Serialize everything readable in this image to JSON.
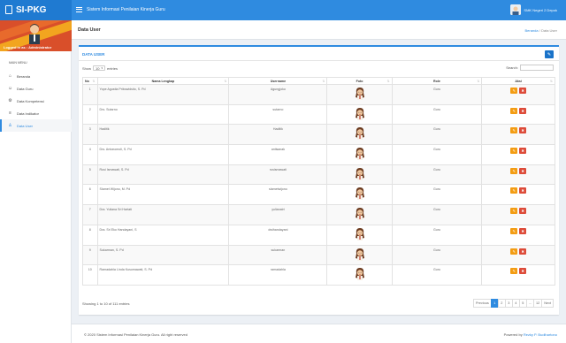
{
  "app": {
    "logo": "SI-PKG",
    "title": "Sistem Informasi Penilaian Kinerja Guru",
    "user_name": "SMK Negeri 2 Depok"
  },
  "sidebar": {
    "logged_in": "Logged in as : Administrator",
    "menu_header": "MAIN MENU",
    "items": [
      {
        "label": "Beranda",
        "icon": "home-icon"
      },
      {
        "label": "Data Guru",
        "icon": "users-icon"
      },
      {
        "label": "Data Kompetensi",
        "icon": "gear-icon"
      },
      {
        "label": "Data Indikator",
        "icon": "list-icon"
      },
      {
        "label": "Data User",
        "icon": "user-icon"
      }
    ]
  },
  "header": {
    "page_title": "Data User",
    "breadcrumb_home": "Beranda",
    "breadcrumb_current": "Data User"
  },
  "box": {
    "title": "DATA USER"
  },
  "table_controls": {
    "show_label": "Show",
    "entries_value": "10",
    "entries_label": "entries",
    "search_label": "Search:"
  },
  "table": {
    "columns": [
      "No",
      "Nama Lengkap",
      "Username",
      "Foto",
      "Role",
      "Aksi"
    ],
    "rows": [
      {
        "no": "1",
        "nama": "Yope Agustia Pribowidsito, S. Pd",
        "username": "Agungjoko",
        "role": "Guru"
      },
      {
        "no": "2",
        "nama": "Drs. Sutarno",
        "username": "sutarno",
        "role": "Guru"
      },
      {
        "no": "3",
        "nama": "Haditik",
        "username": "Haditik",
        "role": "Guru"
      },
      {
        "no": "4",
        "nama": "Drs. Antonomoli, S. Pd",
        "username": "antisanak",
        "role": "Guru"
      },
      {
        "no": "5",
        "nama": "Rusi Ismawati, S. Pd",
        "username": "rusismawati",
        "role": "Guru"
      },
      {
        "no": "6",
        "nama": "Slamet Wijono, M. Pd",
        "username": "slametwijono",
        "role": "Guru"
      },
      {
        "no": "7",
        "nama": "Dra. Yuliana Sri Hartati",
        "username": "yulianatri",
        "role": "Guru"
      },
      {
        "no": "8",
        "nama": "Dra. Sri Eko Handayani, S",
        "username": "dwihandayani",
        "role": "Guru"
      },
      {
        "no": "9",
        "nama": "Sukarman, S. Pd",
        "username": "sukarman",
        "role": "Guru"
      },
      {
        "no": "10",
        "nama": "Ramadahla Linda Kusumawati, S. Pd",
        "username": "ramadahla",
        "role": "Guru"
      }
    ]
  },
  "footer_table": {
    "info": "Showing 1 to 10 of 111 entries",
    "pages": [
      "Previous",
      "1",
      "2",
      "3",
      "4",
      "5",
      "...",
      "12",
      "Next"
    ],
    "active_page": "1"
  },
  "footer": {
    "copyright": "© 2020 Sistem Informasi Penilaian Kinerja Guru. All right reserved",
    "powered_prefix": "Powered by",
    "powered_name": "Rezky P. Budihartono"
  },
  "colors": {
    "primary": "#2f8be0",
    "edit": "#f39c12",
    "delete": "#dd4b39"
  }
}
